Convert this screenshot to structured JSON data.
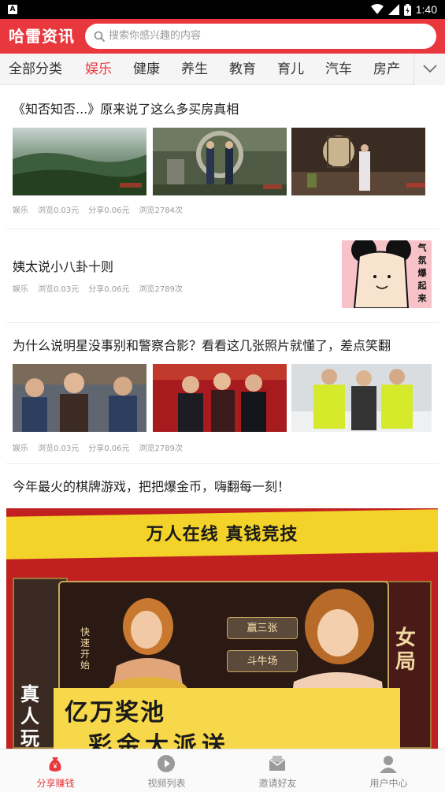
{
  "status_bar": {
    "time": "1:40",
    "icons": [
      "android-icon",
      "wifi-icon",
      "signal-icon",
      "battery-icon"
    ]
  },
  "header": {
    "logo": "哈雷资讯",
    "search_placeholder": "搜索你感兴趣的内容",
    "color": "#e8383d"
  },
  "tabs": [
    {
      "label": "全部分类",
      "active": false
    },
    {
      "label": "娱乐",
      "active": true
    },
    {
      "label": "健康",
      "active": false
    },
    {
      "label": "养生",
      "active": false
    },
    {
      "label": "教育",
      "active": false
    },
    {
      "label": "育儿",
      "active": false
    },
    {
      "label": "汽车",
      "active": false
    },
    {
      "label": "房产",
      "active": false
    }
  ],
  "feed": [
    {
      "title": "《知否知否...》原来说了这么多买房真相",
      "category": "娱乐",
      "browse_price": "浏览0.03元",
      "share_price": "分享0.06元",
      "views": "浏览2784次"
    },
    {
      "title": "姨太说小八卦十则",
      "category": "娱乐",
      "browse_price": "浏览0.03元",
      "share_price": "分享0.06元",
      "views": "浏览2789次",
      "thumb_text": [
        "气",
        "氛",
        "爆",
        "起",
        "来"
      ]
    },
    {
      "title": "为什么说明星没事别和警察合影？看看这几张照片就懂了，差点笑翻",
      "category": "娱乐",
      "browse_price": "浏览0.03元",
      "share_price": "分享0.06元",
      "views": "浏览2789次"
    },
    {
      "title": "今年最火的棋牌游戏，把把爆金币，嗨翻每一刻！"
    }
  ],
  "ad_banner": {
    "headline": "万人在线 真钱竞技",
    "button_1": "赢三张",
    "button_2": "斗牛场",
    "button_3": "快速开始",
    "pool": "亿万奖池",
    "pool_sub": "彩金大派送",
    "side_left": "真人玩",
    "side_right": "女局"
  },
  "bottom_nav": [
    {
      "label": "分享赚钱",
      "icon": "money-bag-icon",
      "active": true
    },
    {
      "label": "视频列表",
      "icon": "play-icon",
      "active": false
    },
    {
      "label": "邀请好友",
      "icon": "mail-icon",
      "active": false
    },
    {
      "label": "用户中心",
      "icon": "user-icon",
      "active": false
    }
  ]
}
